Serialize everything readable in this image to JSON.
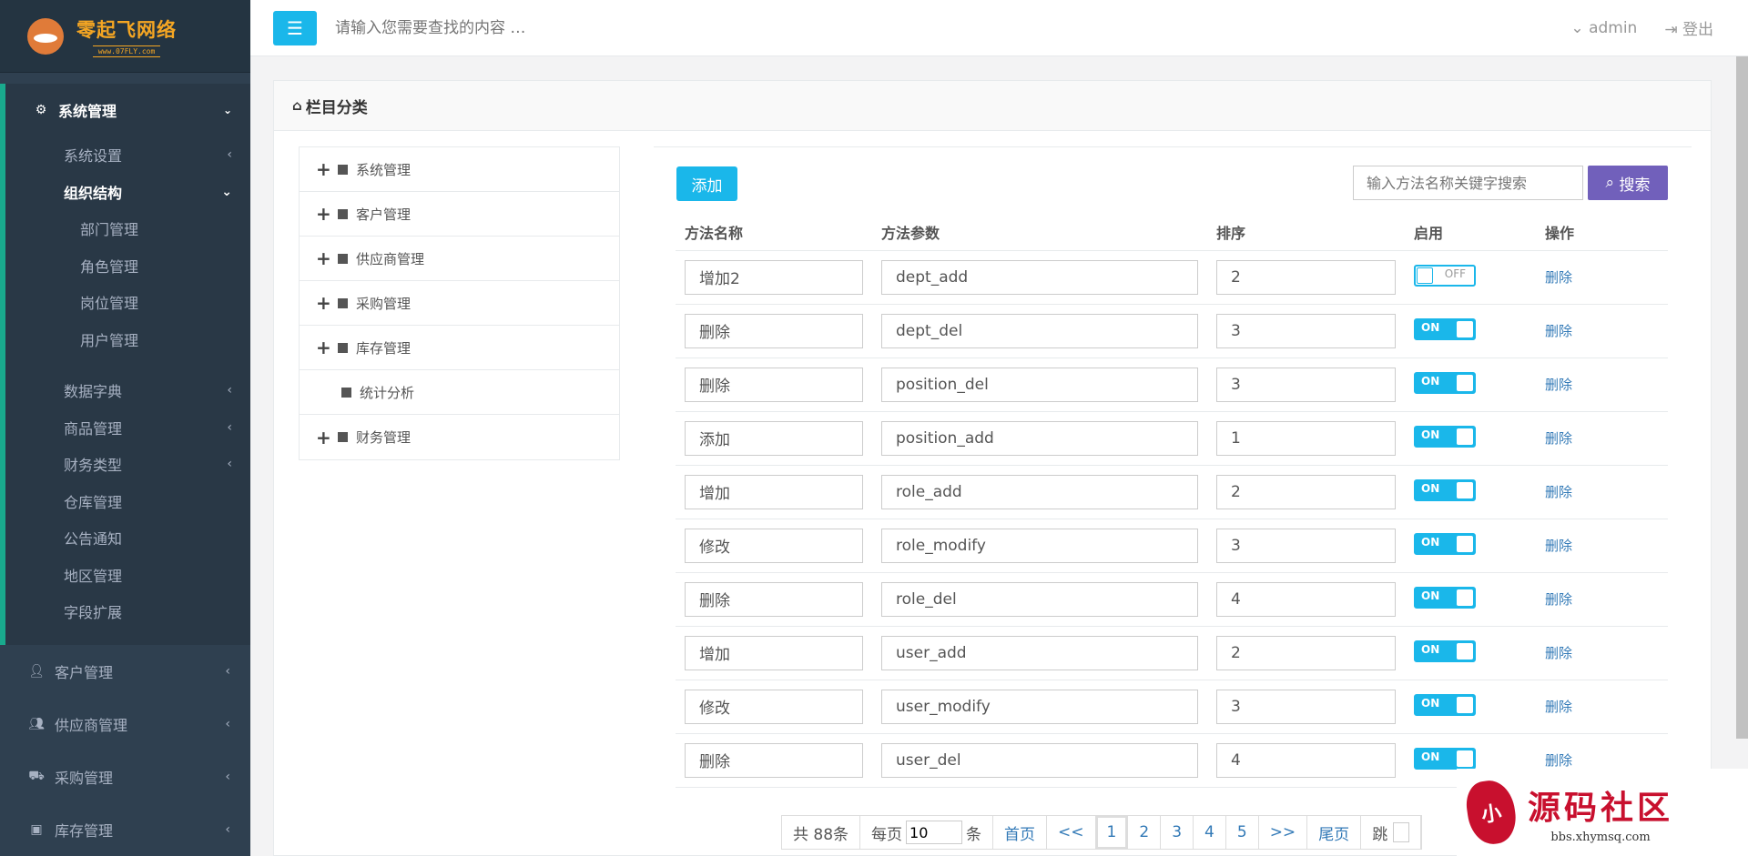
{
  "brand": {
    "name": "零起飞网络",
    "sub": "www.07FLY.com"
  },
  "sidebar": {
    "open_menu": {
      "label": "系统管理",
      "items": [
        {
          "label": "系统设置",
          "arrow": "‹"
        },
        {
          "label": "组织结构",
          "arrow": "⌄",
          "active": true
        }
      ],
      "org_children": [
        "部门管理",
        "角色管理",
        "岗位管理",
        "用户管理"
      ],
      "more_items": [
        {
          "label": "数据字典",
          "arrow": "‹"
        },
        {
          "label": "商品管理",
          "arrow": "‹"
        },
        {
          "label": "财务类型",
          "arrow": "‹"
        },
        {
          "label": "仓库管理",
          "arrow": ""
        },
        {
          "label": "公告通知",
          "arrow": ""
        },
        {
          "label": "地区管理",
          "arrow": ""
        },
        {
          "label": "字段扩展",
          "arrow": ""
        }
      ]
    },
    "outer_items": [
      {
        "label": "客户管理",
        "icon": "user-icon"
      },
      {
        "label": "供应商管理",
        "icon": "users-icon"
      },
      {
        "label": "采购管理",
        "icon": "truck-icon"
      },
      {
        "label": "库存管理",
        "icon": "box-icon"
      }
    ]
  },
  "topbar": {
    "search_placeholder": "请输入您需要查找的内容 …",
    "user": "admin",
    "logout": "登出"
  },
  "panel": {
    "title": "栏目分类"
  },
  "tree": [
    {
      "label": "系统管理",
      "expandable": true
    },
    {
      "label": "客户管理",
      "expandable": true
    },
    {
      "label": "供应商管理",
      "expandable": true
    },
    {
      "label": "采购管理",
      "expandable": true
    },
    {
      "label": "库存管理",
      "expandable": true
    },
    {
      "label": "统计分析",
      "expandable": false
    },
    {
      "label": "财务管理",
      "expandable": true
    }
  ],
  "toolbar": {
    "add_label": "添加",
    "keyword_placeholder": "输入方法名称关键字搜索",
    "search_label": "搜索"
  },
  "table": {
    "headers": [
      "方法名称",
      "方法参数",
      "排序",
      "启用",
      "操作"
    ],
    "rows": [
      {
        "name": "增加2",
        "param": "dept_add",
        "sort": "2",
        "enabled": false,
        "action": "删除"
      },
      {
        "name": "删除",
        "param": "dept_del",
        "sort": "3",
        "enabled": true,
        "action": "删除"
      },
      {
        "name": "删除",
        "param": "position_del",
        "sort": "3",
        "enabled": true,
        "action": "删除"
      },
      {
        "name": "添加",
        "param": "position_add",
        "sort": "1",
        "enabled": true,
        "action": "删除"
      },
      {
        "name": "增加",
        "param": "role_add",
        "sort": "2",
        "enabled": true,
        "action": "删除"
      },
      {
        "name": "修改",
        "param": "role_modify",
        "sort": "3",
        "enabled": true,
        "action": "删除"
      },
      {
        "name": "删除",
        "param": "role_del",
        "sort": "4",
        "enabled": true,
        "action": "删除"
      },
      {
        "name": "增加",
        "param": "user_add",
        "sort": "2",
        "enabled": true,
        "action": "删除"
      },
      {
        "name": "修改",
        "param": "user_modify",
        "sort": "3",
        "enabled": true,
        "action": "删除"
      },
      {
        "name": "删除",
        "param": "user_del",
        "sort": "4",
        "enabled": true,
        "action": "删除"
      }
    ],
    "toggle_on": "ON",
    "toggle_off": "OFF"
  },
  "pagination": {
    "total": "共 88条",
    "per_page_prefix": "每页",
    "per_page_value": "10",
    "per_page_suffix": "条",
    "first": "首页",
    "prev": "<<",
    "pages": [
      "1",
      "2",
      "3",
      "4",
      "5"
    ],
    "current": "1",
    "next": ">>",
    "last": "尾页",
    "jump": "跳"
  },
  "watermark": {
    "title": "源码社区",
    "url": "bbs.xhymsq.com",
    "seal": "小"
  },
  "colors": {
    "sidebar_bg": "#2f4050",
    "accent": "#1ab7ea",
    "search_btn": "#7160bb",
    "active_border": "#19aa8d"
  }
}
